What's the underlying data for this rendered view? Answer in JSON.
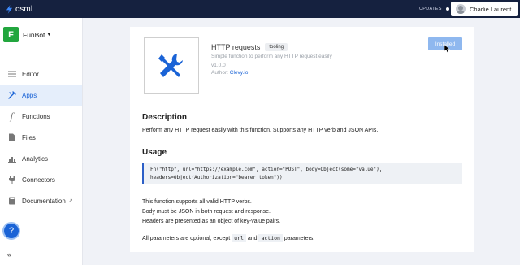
{
  "topbar": {
    "logo_text": "csml",
    "updates_label": "UPDATES",
    "user_name": "Charlie Laurent"
  },
  "sidebar": {
    "bot_initial": "F",
    "bot_name": "FunBot",
    "items": [
      {
        "label": "Editor",
        "icon": "editor-icon"
      },
      {
        "label": "Apps",
        "icon": "apps-icon",
        "active": true
      },
      {
        "label": "Functions",
        "icon": "functions-icon"
      },
      {
        "label": "Files",
        "icon": "files-icon"
      },
      {
        "label": "Analytics",
        "icon": "analytics-icon"
      },
      {
        "label": "Connectors",
        "icon": "connectors-icon"
      },
      {
        "label": "Documentation",
        "icon": "documentation-icon"
      }
    ],
    "help_label": "?",
    "collapse_label": "«"
  },
  "app": {
    "title": "HTTP requests",
    "tag": "tooling",
    "short_description": "Simple function to perform any HTTP request easily",
    "version": "v1.0.0",
    "author_label": "Author:",
    "author_link": "Clevy.io",
    "installed_label": "Installed",
    "description_heading": "Description",
    "description_text": "Perform any HTTP request easily with this function. Supports any HTTP verb and JSON APIs.",
    "usage_heading": "Usage",
    "code_line_1": "Fn(\"http\", url=\"https://example.com\", action=\"POST\", body=Object(some=\"value\"),",
    "code_line_2": "headers=Object(Authorization=\"bearer token\"))",
    "note_1": "This function supports all valid HTTP verbs.",
    "note_2": "Body must be JSON in both request and response.",
    "note_3": "Headers are presented as an object of key-value pairs.",
    "params_prefix": "All parameters are optional, except",
    "param_1": "url",
    "params_and": "and",
    "param_2": "action",
    "params_suffix": "parameters."
  },
  "colors": {
    "topbar": "#15213f",
    "accent": "#1a63d6",
    "bot_badge": "#22a63e",
    "installed_button": "#8fb8ef"
  }
}
